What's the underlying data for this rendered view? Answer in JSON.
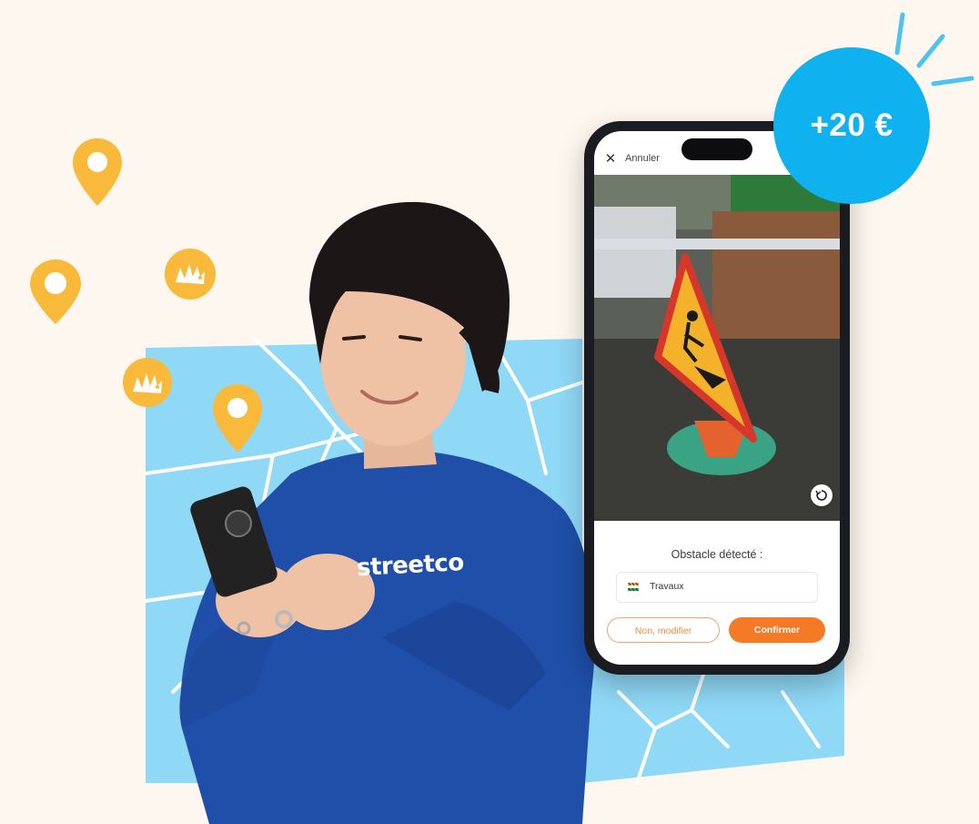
{
  "colors": {
    "background": "#fdf7ef",
    "map": "#8fd8f6",
    "map_roads": "#ffffff",
    "pin": "#f9b93a",
    "badge": "#0fb2ee",
    "confirm": "#f47a26",
    "sweater": "#1f4fa8"
  },
  "brand": {
    "sweater_text": "streetco"
  },
  "phone": {
    "cancel_label": "Annuler",
    "obstacle_title": "Obstacle détecté :",
    "category_label": "Travaux",
    "buttons": {
      "modify_label": "Non, modifier",
      "confirm_label": "Confirmer"
    }
  },
  "reward": {
    "label": "+20 €"
  },
  "icons": [
    "close-icon",
    "rotate-icon",
    "construction-icon",
    "location-pin-icon",
    "hedgehog-icon"
  ]
}
